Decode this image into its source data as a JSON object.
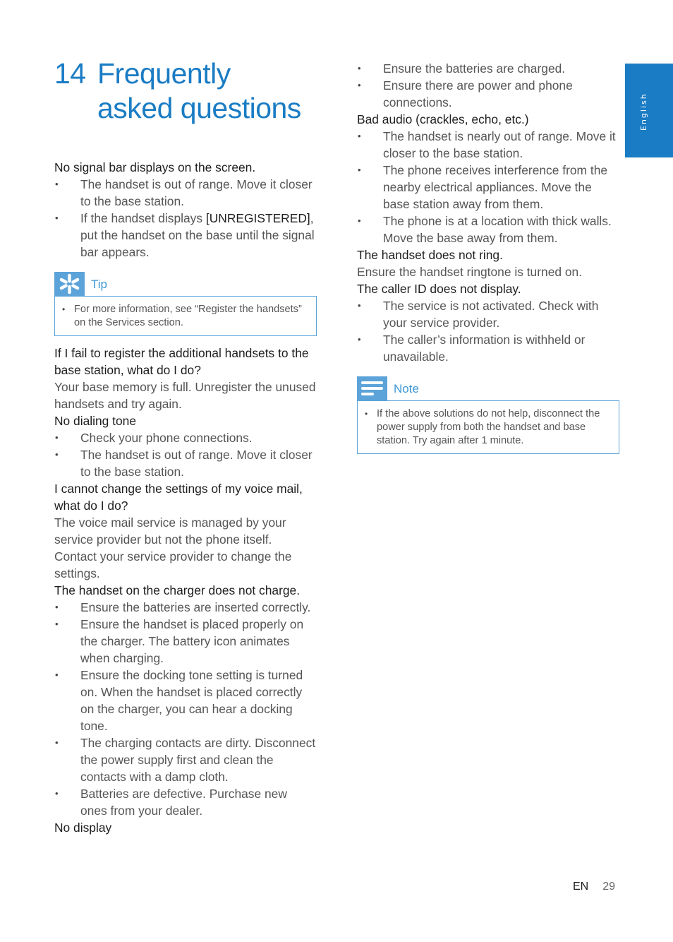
{
  "header": {
    "chapter_number": "14",
    "title_line1": "Frequently",
    "title_line2": "asked questions"
  },
  "language_tab": {
    "label": "English",
    "color": "#1a7cc4"
  },
  "left_column": {
    "q1": {
      "question": "No signal bar displays on the screen.",
      "bullets": [
        "The handset is out of range. Move it closer to the base station."
      ],
      "bullet2_prefix": "If the handset displays ",
      "bullet2_strong": "[UNREGISTERED]",
      "bullet2_suffix": ", put the handset on the base until the signal bar appears."
    },
    "tip": {
      "icon": "asterisk-tip-icon",
      "label": "Tip",
      "items": [
        "For more information, see “Register the handsets” on the Services section."
      ]
    },
    "q2": {
      "question": "If I fail to register the additional handsets to the base station, what do I do?",
      "answer": "Your base memory is full. Unregister the unused handsets and try again."
    },
    "q3": {
      "question": "No dialing tone",
      "bullets": [
        "Check your phone connections.",
        "The handset is out of range. Move it closer to the base station."
      ]
    },
    "q4": {
      "question": "I cannot change the settings of my voice mail, what do I do?",
      "answer": "The voice mail service is managed by your service provider but not the phone itself. Contact your service provider to change the settings."
    },
    "q5": {
      "question": "The handset on the charger does not charge.",
      "bullets": [
        "Ensure the batteries are inserted correctly.",
        "Ensure the handset is placed properly on the charger. The battery icon animates when charging.",
        "Ensure the docking tone setting is turned on. When the handset is placed correctly on the charger, you can hear a docking tone.",
        "The charging contacts are dirty. Disconnect the power supply first and clean the contacts with a damp cloth.",
        "Batteries are defective. Purchase new ones from your dealer."
      ]
    },
    "q6": {
      "question": "No display"
    }
  },
  "right_column": {
    "q6_cont": {
      "bullets": [
        "Ensure the batteries are charged.",
        "Ensure there are power and phone connections."
      ]
    },
    "q7": {
      "question": "Bad audio (crackles, echo, etc.)",
      "bullets": [
        "The handset is nearly out of range. Move it closer to the base station.",
        "The phone receives interference from the nearby electrical appliances. Move the base station away from them.",
        "The phone is at a location with thick walls. Move the base away from them."
      ]
    },
    "q8": {
      "question": "The handset does not ring.",
      "answer": "Ensure the handset ringtone is turned on."
    },
    "q9": {
      "question": "The caller ID does not display.",
      "bullets": [
        "The service is not activated. Check with your service provider.",
        "The caller’s information is withheld or unavailable."
      ]
    },
    "note": {
      "icon": "note-lines-icon",
      "label": "Note",
      "items": [
        "If the above solutions do not help, disconnect the power supply from both the handset and base station. Try again after 1 minute."
      ]
    }
  },
  "footer": {
    "language": "EN",
    "page_number": "29"
  },
  "colors": {
    "accent": "#1a7cc4",
    "callout": "#5ba3d9"
  }
}
